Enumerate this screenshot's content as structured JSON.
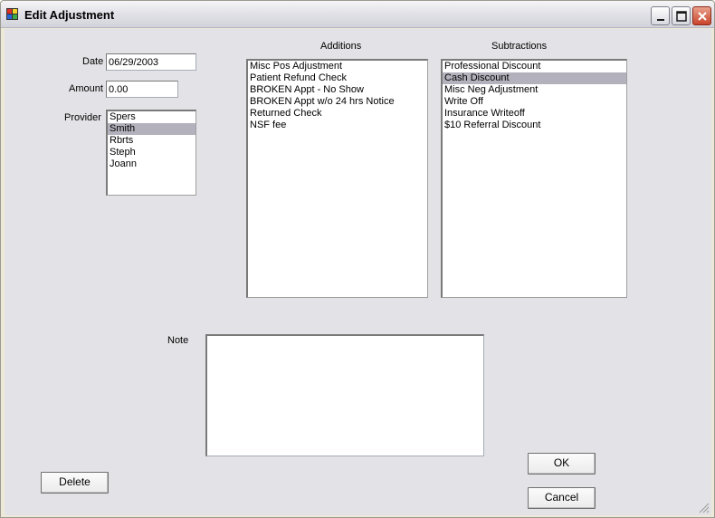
{
  "window": {
    "title": "Edit Adjustment"
  },
  "fields": {
    "date_label": "Date",
    "date_value": "06/29/2003",
    "amount_label": "Amount",
    "amount_value": "0.00",
    "provider_label": "Provider",
    "note_label": "Note",
    "note_value": ""
  },
  "providers": {
    "items": [
      "Spers",
      "Smith",
      "Rbrts",
      "Steph",
      "Joann"
    ],
    "selected_index": 1
  },
  "additions": {
    "header": "Additions",
    "items": [
      "Misc Pos Adjustment",
      "Patient Refund Check",
      "BROKEN Appt - No Show",
      "BROKEN Appt w/o 24 hrs Notice",
      "Returned Check",
      "NSF fee"
    ]
  },
  "subtractions": {
    "header": "Subtractions",
    "items": [
      "Professional Discount",
      "Cash Discount",
      "Misc Neg Adjustment",
      "Write Off",
      "Insurance Writeoff",
      "$10 Referral Discount"
    ],
    "selected_index": 1
  },
  "buttons": {
    "ok": "OK",
    "cancel": "Cancel",
    "delete": "Delete"
  },
  "colors": {
    "selection": "#b3b1bc",
    "client_bg": "#e3e2e6"
  },
  "icons": {
    "app": "app-icon",
    "minimize": "minimize-icon",
    "maximize": "maximize-icon",
    "close": "close-icon",
    "resize": "resize-grip-icon"
  }
}
